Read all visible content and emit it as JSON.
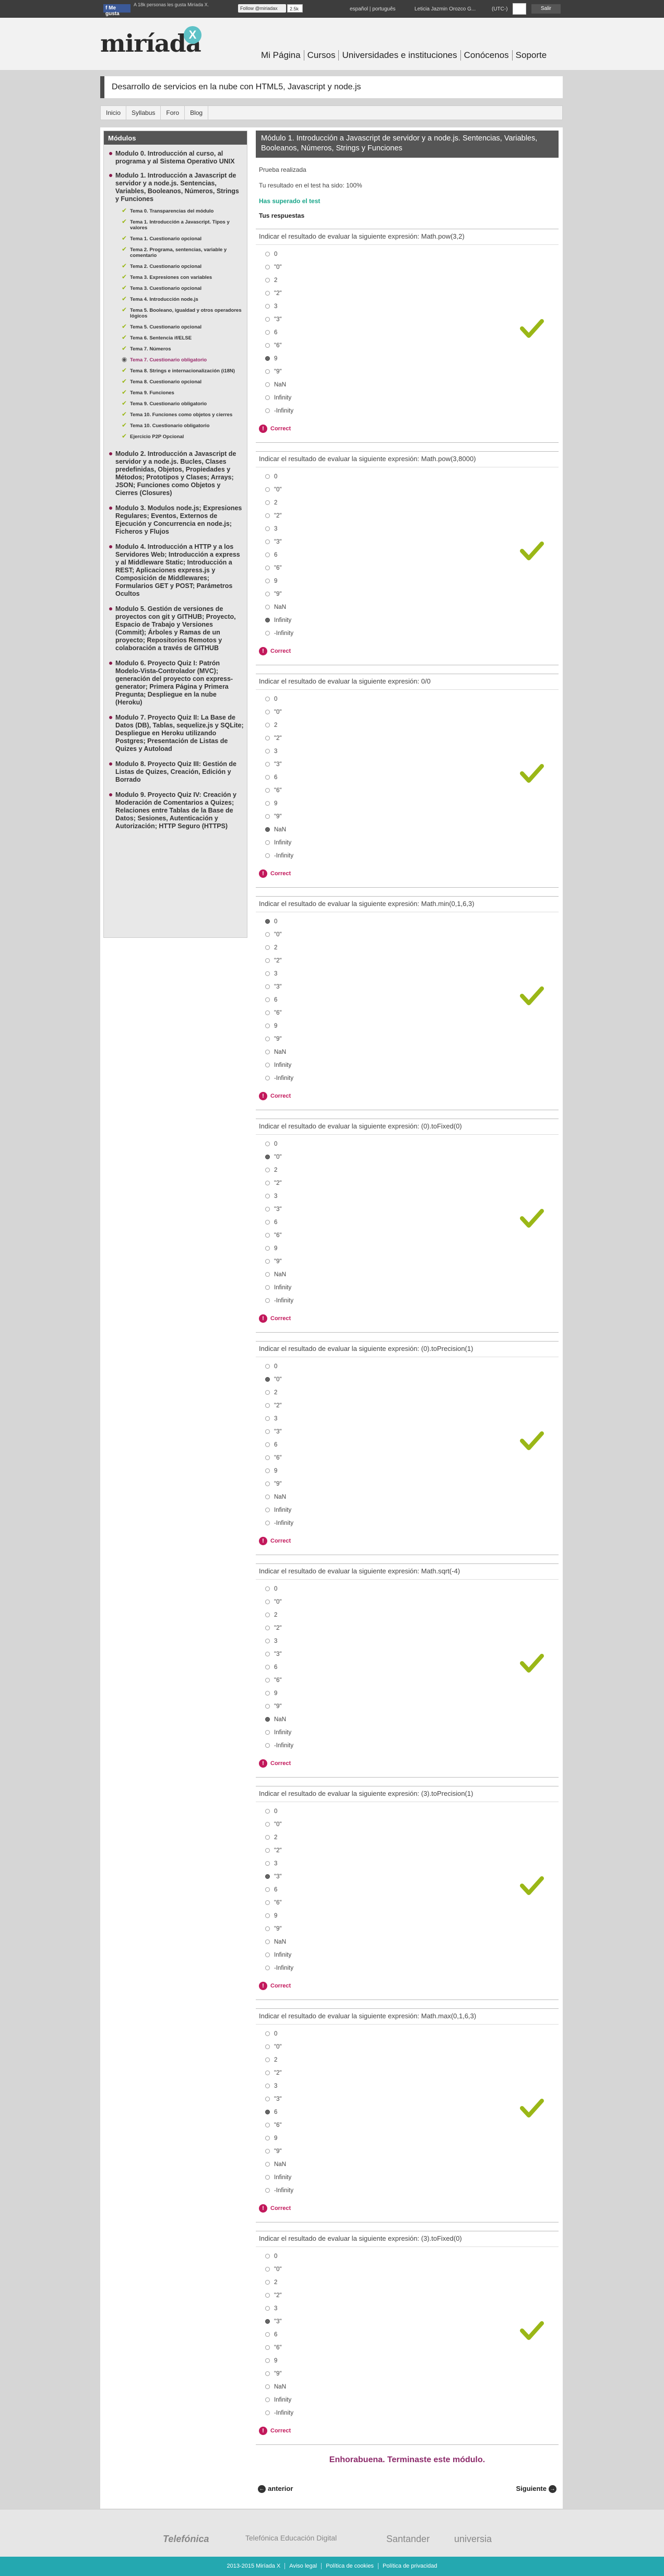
{
  "topbar": {
    "fb_label": "f Me gusta",
    "fb_text": "A 18k personas les gusta Miríada X.",
    "twitter_label": "Follow @miriadax",
    "twitter_count": "2.5k",
    "lang": "español | português",
    "user": "Leticia Jazmin Orozco G...",
    "timezone": "(UTC-)",
    "logout": "Salir"
  },
  "header": {
    "logo": "miríada",
    "badge": "X",
    "nav": [
      "Mi Página",
      "Cursos",
      "Universidades e instituciones",
      "Conócenos",
      "Soporte"
    ]
  },
  "course": {
    "title": "Desarrollo de servicios en la nube con HTML5, Javascript y node.js"
  },
  "subnav": [
    "Inicio",
    "Syllabus",
    "Foro",
    "Blog"
  ],
  "sidebar": {
    "title": "Módulos",
    "modules_a": [
      "Modulo 0. Introducción al curso, al programa y al Sistema Operativo UNIX",
      "Modulo 1. Introducción a Javascript de servidor y a node.js. Sentencias, Variables, Booleanos, Números, Strings y Funciones"
    ],
    "topics": [
      "Tema 0. Transparencias del módulo",
      "Tema 1. Introducción a Javascript. Tipos y valores",
      "Tema 1. Cuestionario opcional",
      "Tema 2. Programa, sentencias, variable y comentario",
      "Tema 2. Cuestionario opcional",
      "Tema 3. Expresiones con variables",
      "Tema 3. Cuestionario opcional",
      "Tema 4. Introducción node.js",
      "Tema 5. Booleano, igualdad y otros operadores lógicos",
      "Tema 5. Cuestionario opcional",
      "Tema 6. Sentencia if/ELSE",
      "Tema 7. Números",
      "Tema 7. Cuestionario obligatorio",
      "Tema 8. Strings e internacionalización (i18N)",
      "Tema 8. Cuestionario opcional",
      "Tema 9. Funciones",
      "Tema 9. Cuestionario obligatorio",
      "Tema 10. Funciones como objetos y cierres",
      "Tema 10. Cuestionario obligatorio",
      "Ejercicio P2P Opcional"
    ],
    "modules_b": [
      "Modulo 2. Introducción a Javascript de servidor y a node.js. Bucles, Clases predefinidas, Objetos, Propiedades y Métodos; Prototipos y Clases; Arrays; JSON; Funciones como Objetos y Cierres (Closures)",
      "Modulo 3. Modulos node.js; Expresiones Regulares; Eventos, Externos de Ejecución y Concurrencia en node.js; Ficheros y Flujos",
      "Modulo 4. Introducción a HTTP y a los Servidores Web; Introducción a express y al Middleware Static; Introducción a REST; Aplicaciones express.js y Composición de Middlewares; Formularios GET y POST; Parámetros Ocultos",
      "Modulo 5. Gestión de versiones de proyectos con git y GITHUB; Proyecto, Espacio de Trabajo y Versiones (Commit); Árboles y Ramas de un proyecto; Repositorios Remotos y colaboración a través de GITHUB",
      "Modulo 6. Proyecto Quiz I: Patrón Modelo-Vista-Controlador (MVC); generación del proyecto con express-generator; Primera Página y Primera Pregunta; Despliegue en la nube (Heroku)",
      "Modulo 7. Proyecto Quiz II: La Base de Datos (DB), Tablas, sequelize.js y SQLite; Despliegue en Heroku utilizando Postgres; Presentación de Listas de Quizes y Autoload",
      "Modulo 8. Proyecto Quiz III: Gestión de Listas de Quizes, Creación, Edición y Borrado",
      "Modulo 9. Proyecto Quiz IV: Creación y Moderación de Comentarios a Quizes; Relaciones entre Tablas de la Base de Datos; Sesiones, Autenticación y Autorización; HTTP Seguro (HTTPS)"
    ]
  },
  "unit": {
    "title": "Módulo 1. Introducción a Javascript de servidor y a node.js. Sentencias, Variables, Booleanos, Números, Strings y Funciones",
    "test_done": "Prueba realizada",
    "score": "Tu resultado en el test ha sido: 100%",
    "passed": "Has superado el test",
    "answers_label": "Tus respuestas"
  },
  "options": [
    "0",
    "\"0\"",
    "2",
    "\"2\"",
    "3",
    "\"3\"",
    "6",
    "\"6\"",
    "9",
    "\"9\"",
    "NaN",
    "Infinity",
    "-Infinity"
  ],
  "questions": [
    {
      "title": "Indicar el resultado de evaluar la siguiente expresión: Math.pow(3,2)",
      "selected": 8,
      "result": "Correct"
    },
    {
      "title": "Indicar el resultado de evaluar la siguiente expresión: Math.pow(3,8000)",
      "selected": 11,
      "result": "Correct"
    },
    {
      "title": "Indicar el resultado de evaluar la siguiente expresión: 0/0",
      "selected": 10,
      "result": "Correct"
    },
    {
      "title": "Indicar el resultado de evaluar la siguiente expresión: Math.min(0,1,6,3)",
      "selected": 0,
      "result": "Correct"
    },
    {
      "title": "Indicar el resultado de evaluar la siguiente expresión: (0).toFixed(0)",
      "selected": 1,
      "result": "Correct"
    },
    {
      "title": "Indicar el resultado de evaluar la siguiente expresión: (0).toPrecision(1)",
      "selected": 1,
      "result": "Correct"
    },
    {
      "title": "Indicar el resultado de evaluar la siguiente expresión: Math.sqrt(-4)",
      "selected": 10,
      "result": "Correct"
    },
    {
      "title": "Indicar el resultado de evaluar la siguiente expresión: (3).toPrecision(1)",
      "selected": 5,
      "result": "Correct"
    },
    {
      "title": "Indicar el resultado de evaluar la siguiente expresión: Math.max(0,1,6,3)",
      "selected": 6,
      "result": "Correct"
    },
    {
      "title": "Indicar el resultado de evaluar la siguiente expresión: (3).toFixed(0)",
      "selected": 5,
      "result": "Correct"
    }
  ],
  "congrats": "Enhorabuena. Terminaste este módulo.",
  "nav": {
    "prev": "anterior",
    "next": "Siguiente"
  },
  "sponsors": [
    "Telefónica",
    "Telefónica Educación Digital",
    "Santander",
    "universia"
  ],
  "footer": [
    "2013-2015 Miríada X",
    "Aviso legal",
    "Política de cookies",
    "Política de privacidad"
  ],
  "colors": {
    "accent": "#9ab717",
    "magenta": "#c2185b",
    "teal": "#24a8b0"
  }
}
